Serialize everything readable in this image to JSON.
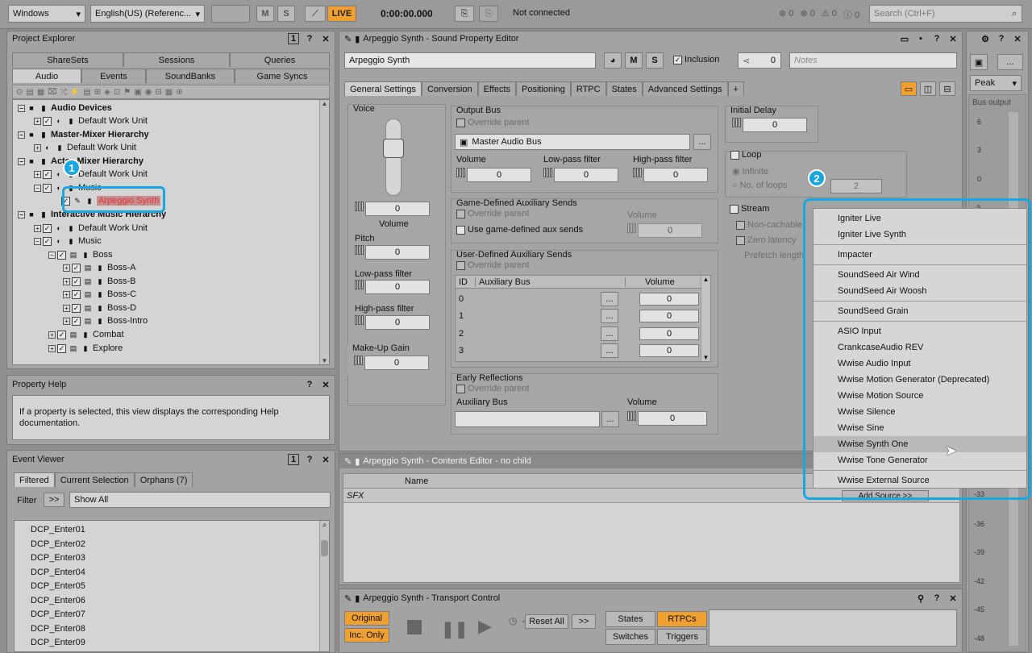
{
  "toolbar": {
    "platform": "Windows",
    "language": "English(US) (Referenc...",
    "m_label": "M",
    "s_label": "S",
    "live_label": "LIVE",
    "time": "0:00:00.000",
    "connection": "Not connected",
    "err_count": "0",
    "warn_count": "0",
    "info_count": "0",
    "msg_count": "0",
    "search_placeholder": "Search (Ctrl+F)"
  },
  "project_explorer": {
    "title": "Project Explorer",
    "tabs_top": [
      "ShareSets",
      "Sessions",
      "Queries"
    ],
    "tabs_bottom": [
      "Audio",
      "Events",
      "SoundBanks",
      "Game Syncs"
    ],
    "tree": [
      {
        "label": "Audio Devices",
        "bold": true
      },
      {
        "label": "Default Work Unit"
      },
      {
        "label": "Master-Mixer Hierarchy",
        "bold": true
      },
      {
        "label": "Default Work Unit"
      },
      {
        "label": "Actor-Mixer Hierarchy",
        "bold": true
      },
      {
        "label": "Default Work Unit"
      },
      {
        "label": "Music"
      },
      {
        "label": "Arpeggio Synth"
      },
      {
        "label": "Interactive Music Hierarchy",
        "bold": true
      },
      {
        "label": "Default Work Unit"
      },
      {
        "label": "Music"
      },
      {
        "label": "Boss"
      },
      {
        "label": "Boss-A"
      },
      {
        "label": "Boss-B"
      },
      {
        "label": "Boss-C"
      },
      {
        "label": "Boss-D"
      },
      {
        "label": "Boss-Intro"
      },
      {
        "label": "Combat"
      },
      {
        "label": "Explore"
      }
    ]
  },
  "property_help": {
    "title": "Property Help",
    "text": "If a property is selected, this view displays the corresponding Help documentation."
  },
  "event_viewer": {
    "title": "Event Viewer",
    "tabs": [
      "Filtered",
      "Current Selection",
      "Orphans (7)"
    ],
    "filter_label": "Filter",
    "filter_btn": ">>",
    "filter_value": "Show All",
    "events": [
      "DCP_Enter01",
      "DCP_Enter02",
      "DCP_Enter03",
      "DCP_Enter04",
      "DCP_Enter05",
      "DCP_Enter06",
      "DCP_Enter07",
      "DCP_Enter08",
      "DCP_Enter09"
    ]
  },
  "sound_editor": {
    "title": "Arpeggio Synth - Sound Property Editor",
    "name": "Arpeggio Synth",
    "m_label": "M",
    "s_label": "S",
    "inclusion": "Inclusion",
    "ref_count": "0",
    "notes_placeholder": "Notes",
    "tabs": [
      "General Settings",
      "Conversion",
      "Effects",
      "Positioning",
      "RTPC",
      "States",
      "Advanced Settings",
      "+"
    ],
    "voice": {
      "label": "Voice",
      "volume_val": "0",
      "volume_label": "Volume",
      "pitch_label": "Pitch",
      "pitch_val": "0",
      "lpf_label": "Low-pass filter",
      "lpf_val": "0",
      "hpf_label": "High-pass filter",
      "hpf_val": "0",
      "makeup_label": "Make-Up Gain",
      "makeup_val": "0"
    },
    "output_bus": {
      "label": "Output Bus",
      "override": "Override parent",
      "bus": "Master Audio Bus",
      "browse": "...",
      "volume_label": "Volume",
      "volume_val": "0",
      "lpf_label": "Low-pass filter",
      "lpf_val": "0",
      "hpf_label": "High-pass filter",
      "hpf_val": "0"
    },
    "game_aux": {
      "label": "Game-Defined Auxiliary Sends",
      "override": "Override parent",
      "use": "Use game-defined aux sends",
      "volume_label": "Volume",
      "volume_val": "0"
    },
    "user_aux": {
      "label": "User-Defined Auxiliary Sends",
      "override": "Override parent",
      "col_id": "ID",
      "col_bus": "Auxiliary Bus",
      "col_volume": "Volume",
      "rows": [
        {
          "id": "0",
          "vol": "0"
        },
        {
          "id": "1",
          "vol": "0"
        },
        {
          "id": "2",
          "vol": "0"
        },
        {
          "id": "3",
          "vol": "0"
        }
      ]
    },
    "early": {
      "label": "Early Reflections",
      "override": "Override parent",
      "aux_label": "Auxiliary Bus",
      "volume_label": "Volume",
      "volume_val": "0"
    },
    "initial_delay": {
      "label": "Initial Delay",
      "val": "0"
    },
    "loop": {
      "label": "Loop",
      "infinite": "Infinite",
      "no_loops": "No. of loops",
      "loops_val": "2"
    },
    "stream": {
      "label": "Stream",
      "non_cachable": "Non-cachable",
      "zero_latency": "Zero latency",
      "prefetch": "Prefetch length"
    }
  },
  "contents_editor": {
    "title": "Arpeggio Synth - Contents Editor - no child",
    "col_name": "Name",
    "row": "SFX",
    "add_source": "Add Source >>"
  },
  "transport": {
    "title": "Arpeggio Synth - Transport Control",
    "original": "Original",
    "inc_only": "Inc. Only",
    "reset_all": "Reset All",
    "more": ">>",
    "states": "States",
    "rtpcs": "RTPCs",
    "switches": "Switches",
    "triggers": "Triggers"
  },
  "meter": {
    "mode": "Peak",
    "label": "Bus output",
    "ticks": [
      "6",
      "3",
      "0",
      "-3",
      "-33",
      "-36",
      "-39",
      "-42",
      "-45",
      "-48"
    ]
  },
  "dropdown_menu": {
    "groups": [
      [
        "Igniter Live",
        "Igniter Live Synth"
      ],
      [
        "Impacter"
      ],
      [
        "SoundSeed Air Wind",
        "SoundSeed Air Woosh"
      ],
      [
        "SoundSeed Grain"
      ],
      [
        "ASIO Input",
        "CrankcaseAudio REV",
        "Wwise Audio Input",
        "Wwise Motion Generator (Deprecated)",
        "Wwise Motion Source",
        "Wwise Silence",
        "Wwise Sine",
        "Wwise Synth One",
        "Wwise Tone Generator"
      ],
      [
        "Wwise External Source"
      ]
    ],
    "hovered": "Wwise Synth One"
  },
  "callouts": [
    "1",
    "2"
  ],
  "colors": {
    "accent": "#1aa6e0",
    "live": "#f0a030",
    "highlight_red": "#d83b3b"
  }
}
